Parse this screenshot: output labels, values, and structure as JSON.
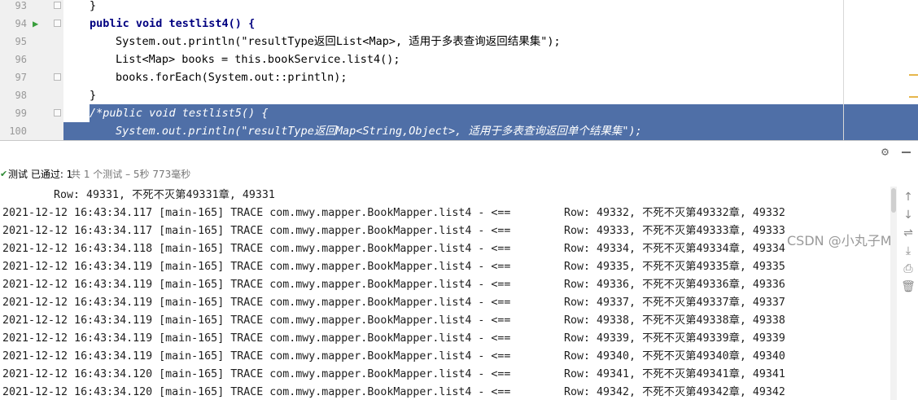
{
  "editor": {
    "lines": [
      {
        "num": "93",
        "text": "}"
      },
      {
        "num": "94",
        "text": "public void testlist4() {"
      },
      {
        "num": "95",
        "text": "System.out.println(\"resultType返回List<Map>, 适用于多表查询返回结果集\");"
      },
      {
        "num": "96",
        "text": "List<Map> books = this.bookService.list4();"
      },
      {
        "num": "97",
        "text": "books.forEach(System.out::println);"
      },
      {
        "num": "98",
        "text": "}"
      },
      {
        "num": "99",
        "text": "/*public void testlist5() {"
      },
      {
        "num": "100",
        "text": "System.out.println(\"resultType返回Map<String,Object>, 适用于多表查询返回单个结果集\");"
      }
    ],
    "run_icon": "run-test-icon",
    "selection_color": "#4f6fa7"
  },
  "panel": {
    "gear_icon": "gear-icon",
    "minimize_icon": "minimize-icon",
    "status": {
      "check_icon": "test-passed-icon",
      "label": "测试 已通过: 1",
      "detail": "共 1 个测试 – 5秒 773毫秒"
    },
    "console": {
      "first_row": "Row: 49331, 不死不灭第49331章, 49331",
      "log_prefix": "[main-165] TRACE com.mwy.mapper.BookMapper.list4 - <==",
      "lines": [
        {
          "ts": "2021-12-12 16:43:34.117",
          "row": "Row: 49332, 不死不灭第49332章, 49332"
        },
        {
          "ts": "2021-12-12 16:43:34.117",
          "row": "Row: 49333, 不死不灭第49333章, 49333"
        },
        {
          "ts": "2021-12-12 16:43:34.118",
          "row": "Row: 49334, 不死不灭第49334章, 49334"
        },
        {
          "ts": "2021-12-12 16:43:34.119",
          "row": "Row: 49335, 不死不灭第49335章, 49335"
        },
        {
          "ts": "2021-12-12 16:43:34.119",
          "row": "Row: 49336, 不死不灭第49336章, 49336"
        },
        {
          "ts": "2021-12-12 16:43:34.119",
          "row": "Row: 49337, 不死不灭第49337章, 49337"
        },
        {
          "ts": "2021-12-12 16:43:34.119",
          "row": "Row: 49338, 不死不灭第49338章, 49338"
        },
        {
          "ts": "2021-12-12 16:43:34.119",
          "row": "Row: 49339, 不死不灭第49339章, 49339"
        },
        {
          "ts": "2021-12-12 16:43:34.119",
          "row": "Row: 49340, 不死不灭第49340章, 49340"
        },
        {
          "ts": "2021-12-12 16:43:34.120",
          "row": "Row: 49341, 不死不灭第49341章, 49341"
        },
        {
          "ts": "2021-12-12 16:43:34.120",
          "row": "Row: 49342, 不死不灭第49342章, 49342"
        }
      ]
    },
    "side_tools": [
      "arrow-up-icon",
      "arrow-down-icon",
      "soft-wrap-icon",
      "scroll-to-end-icon",
      "print-icon",
      "clear-all-icon"
    ]
  },
  "watermark": "CSDN @小丸子M"
}
